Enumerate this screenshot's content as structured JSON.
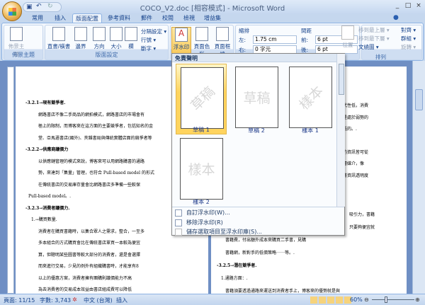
{
  "window": {
    "title": "COCO_V2.doc [相容模式] - Microsoft Word",
    "min": "_",
    "max": "□",
    "close": "×"
  },
  "tabs": [
    {
      "label": "常用"
    },
    {
      "label": "插入"
    },
    {
      "label": "版面配置",
      "active": true
    },
    {
      "label": "參考資料"
    },
    {
      "label": "郵件"
    },
    {
      "label": "校閱"
    },
    {
      "label": "檢視"
    },
    {
      "label": "增益集"
    }
  ],
  "ribbon": {
    "themes": {
      "label": "佈景主題",
      "button": "佈景主題"
    },
    "page_setup": {
      "label": "版面設定",
      "buttons": [
        "直書/橫書",
        "邊界",
        "方向",
        "大小",
        "欄"
      ],
      "small": [
        "分隔設定 ▾",
        "行號 ▾",
        "斷字 ▾"
      ]
    },
    "page_background": {
      "buttons": [
        "浮水印",
        "頁面色彩",
        "頁面框線"
      ]
    },
    "paragraph": {
      "indent_label": "縮排",
      "left_label": "左:",
      "left_value": "1.75 cm",
      "right_label": "右:",
      "right_value": "0 字元",
      "spacing_label": "間距",
      "before_label": "前:",
      "before_value": "6 pt",
      "after_label": "後:",
      "after_value": "6 pt"
    },
    "arrange": {
      "label": "排列",
      "position": "位置",
      "items": [
        "移到最上層 ▾",
        "移到最下層 ▾",
        "文繞圖 ▾",
        "對齊 ▾",
        "群組 ▾",
        "旋轉 ▾"
      ]
    }
  },
  "watermark_menu": {
    "section": "免責聲明",
    "items": [
      {
        "label": "草稿 1",
        "text": "草稿",
        "diagonal": true,
        "selected": true
      },
      {
        "label": "草稿 2",
        "text": "草稿",
        "diagonal": false
      },
      {
        "label": "樣本 1",
        "text": "樣本",
        "diagonal": true
      },
      {
        "label": "樣本 2",
        "text": "樣本",
        "diagonal": false
      }
    ],
    "commands": [
      {
        "label": "自訂浮水印(W)...",
        "enabled": true
      },
      {
        "label": "移除浮水印(R)",
        "enabled": true
      },
      {
        "label": "儲存選取項目至浮水印庫(S)...",
        "enabled": false
      }
    ]
  },
  "document": {
    "left": [
      "-3.2.1→現有競爭者.",
      "網路書店不像二手商品的網拍模式，網路書店的市場會有",
      "極上的限制，而博客來在這方面的主要競爭者，包括知名的金",
      "堂、亞馬遜書店(國外)、夾雜書局與傳統實體店面的競爭者等",
      "-3.2.2→供應商議價力",
      "以供應鏈管理的模式來說，博客來可以用網路購書的通路",
      "勢，來達到「集量」管理，也符合 Pull-based model 的形式",
      "在傳統書店的交易庫存量會比網路書店多準備一些較保",
      "Pull-based model。.",
      "-3.2.3→消費者議價力.",
      "1.→購買數量.",
      "消費者在購買書籍時，以集合眾人之需求，整合，一至多",
      "多本組合的方式購買會比在傳統書店單買一本較為便宜",
      "算，但聰明某些圖書等較大部分的消費者，還是會選擇",
      "而來進行交易，少見的例外有組織購書時，才能享有8",
      "以上的優惠方案，消費者擁有團購則議價能力不高",
      "為去消費者的交易成本效益由書店組成費可以降低"
    ],
    "right_top": [
      "替代性低，消費",
      "，是處於弱勢的",
      "價低的。.",
      "要的資訊皆可從",
      "一層媒介，像",
      "，將資訊透明度"
    ],
    "right_bottom": [
      "吸引力，書籍",
      "只要夠便宜就",
      "書籍費，付出額外成本來購買二手書，見購",
      "書籍網，新對手的低價策略⋯⋯等。.",
      "-3.2.5→潛在競爭者.",
      "1.通路方面：.",
      "書籍須要透過通路來運送到消費者手上，博客來的優勢就是與"
    ]
  },
  "status": {
    "page": "頁面: 11/15",
    "words": "字數: 3,743",
    "language": "中文 (台灣)",
    "mode": "插入",
    "zoom": "60%",
    "zoom_level": 60
  }
}
